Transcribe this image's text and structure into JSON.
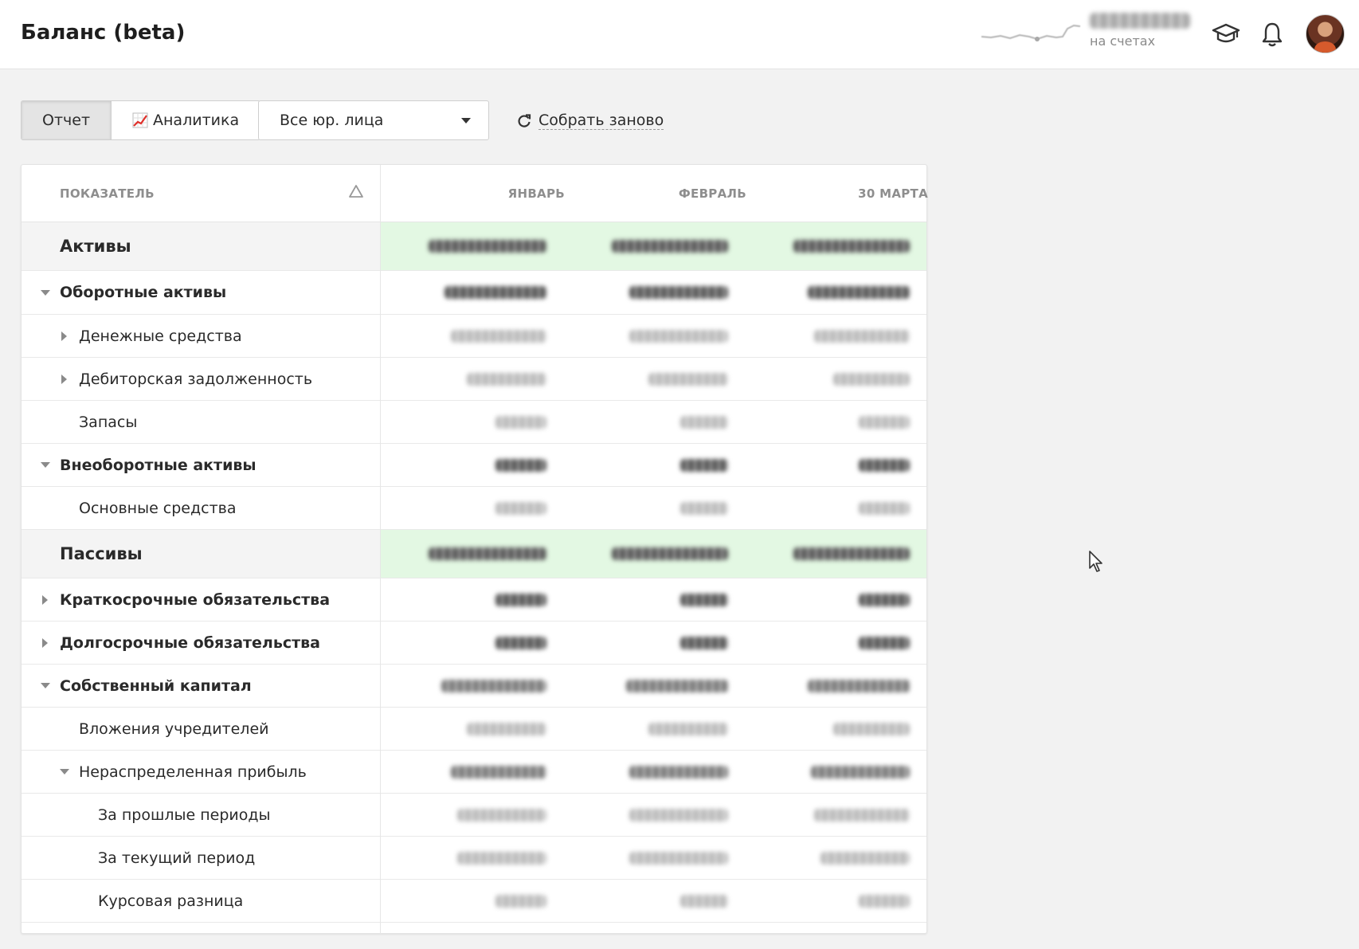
{
  "header": {
    "title": "Баланс (beta)",
    "balance_label": "на счетах"
  },
  "toolbar": {
    "tab_report": "Отчет",
    "tab_analytics": "Аналитика",
    "entity_select": "Все юр. лица",
    "rebuild": "Собрать заново"
  },
  "table": {
    "columns": {
      "indicator": "ПОКАЗАТЕЛЬ",
      "m1": "ЯНВАРЬ",
      "m2": "ФЕВРАЛЬ",
      "m3": "30 МАРТА"
    },
    "rows": [
      {
        "label": "Активы"
      },
      {
        "label": "Оборотные активы"
      },
      {
        "label": "Денежные средства"
      },
      {
        "label": "Дебиторская задолженность"
      },
      {
        "label": "Запасы"
      },
      {
        "label": "Внеоборотные активы"
      },
      {
        "label": "Основные средства"
      },
      {
        "label": "Пассивы"
      },
      {
        "label": "Краткосрочные обязательства"
      },
      {
        "label": "Долгосрочные обязательства"
      },
      {
        "label": "Собственный капитал"
      },
      {
        "label": "Вложения учредителей"
      },
      {
        "label": "Нераспределенная прибыль"
      },
      {
        "label": "За прошлые периоды"
      },
      {
        "label": "За текущий период"
      },
      {
        "label": "Курсовая разница"
      }
    ]
  },
  "colors": {
    "section_highlight": "#e3f8e3",
    "page_bg": "#f2f2f2"
  },
  "icons": [
    "sparkline-chart",
    "graduation-cap-icon",
    "bell-icon",
    "user-avatar",
    "chart-increasing-icon",
    "caret-down-icon",
    "refresh-icon",
    "sort-triangle-icon",
    "expand-triangle-icon",
    "collapse-triangle-icon",
    "mouse-cursor-icon"
  ]
}
